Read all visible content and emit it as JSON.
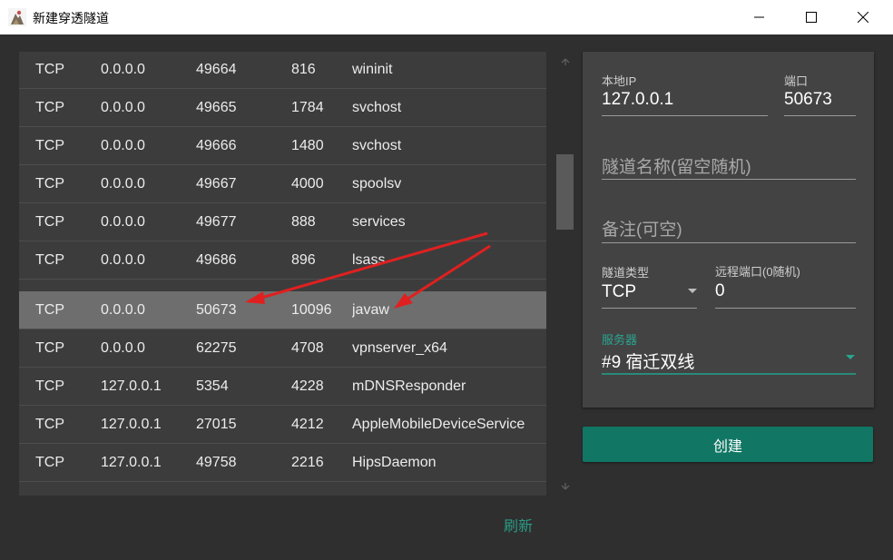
{
  "window": {
    "title": "新建穿透隧道",
    "buttons": [
      "minimize",
      "maximize",
      "close"
    ]
  },
  "table": {
    "rows": [
      {
        "proto": "TCP",
        "ip": "0.0.0.0",
        "port": "49664",
        "pid": "816",
        "name": "wininit"
      },
      {
        "proto": "TCP",
        "ip": "0.0.0.0",
        "port": "49665",
        "pid": "1784",
        "name": "svchost"
      },
      {
        "proto": "TCP",
        "ip": "0.0.0.0",
        "port": "49666",
        "pid": "1480",
        "name": "svchost"
      },
      {
        "proto": "TCP",
        "ip": "0.0.0.0",
        "port": "49667",
        "pid": "4000",
        "name": "spoolsv"
      },
      {
        "proto": "TCP",
        "ip": "0.0.0.0",
        "port": "49677",
        "pid": "888",
        "name": "services"
      },
      {
        "proto": "TCP",
        "ip": "0.0.0.0",
        "port": "49686",
        "pid": "896",
        "name": "lsass"
      },
      {
        "proto": "TCP",
        "ip": "0.0.0.0",
        "port": "50673",
        "pid": "10096",
        "name": "javaw",
        "selected": true
      },
      {
        "proto": "TCP",
        "ip": "0.0.0.0",
        "port": "62275",
        "pid": "4708",
        "name": "vpnserver_x64"
      },
      {
        "proto": "TCP",
        "ip": "127.0.0.1",
        "port": "5354",
        "pid": "4228",
        "name": "mDNSResponder"
      },
      {
        "proto": "TCP",
        "ip": "127.0.0.1",
        "port": "27015",
        "pid": "4212",
        "name": "AppleMobileDeviceService"
      },
      {
        "proto": "TCP",
        "ip": "127.0.0.1",
        "port": "49758",
        "pid": "2216",
        "name": "HipsDaemon"
      }
    ]
  },
  "form": {
    "local_ip_label": "本地IP",
    "local_ip_value": "127.0.0.1",
    "port_label": "端口",
    "port_value": "50673",
    "tunnel_name_placeholder": "隧道名称(留空随机)",
    "remark_placeholder": "备注(可空)",
    "tunnel_type_label": "隧道类型",
    "tunnel_type_value": "TCP",
    "remote_port_label": "远程端口(0随机)",
    "remote_port_value": "0",
    "server_label": "服务器",
    "server_value": "#9 宿迁双线"
  },
  "actions": {
    "create_label": "创建",
    "refresh_label": "刷新"
  },
  "colors": {
    "accent": "#117764",
    "accent_text": "#2aa58f",
    "annotation_arrow": "#e02020"
  }
}
